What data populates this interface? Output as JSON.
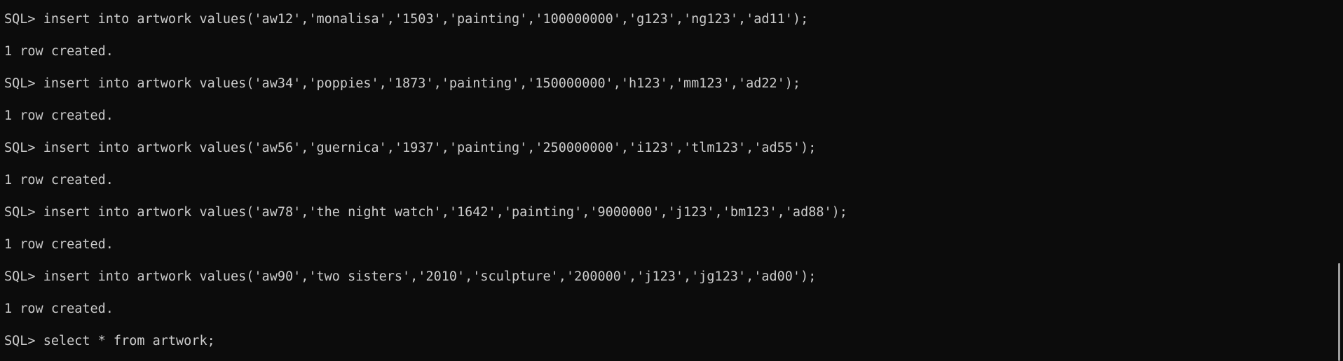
{
  "terminal": {
    "background": "#0c0c0c",
    "foreground": "#cccccc",
    "scrollbar_color": "#9e9e9e",
    "lines": [
      "SQL> insert into artwork values('aw12','monalisa','1503','painting','100000000','g123','ng123','ad11');",
      "1 row created.",
      "SQL> insert into artwork values('aw34','poppies','1873','painting','150000000','h123','mm123','ad22');",
      "1 row created.",
      "SQL> insert into artwork values('aw56','guernica','1937','painting','250000000','i123','tlm123','ad55');",
      "1 row created.",
      "SQL> insert into artwork values('aw78','the night watch','1642','painting','9000000','j123','bm123','ad88');",
      "1 row created.",
      "SQL> insert into artwork values('aw90','two sisters','2010','sculpture','200000','j123','jg123','ad00');",
      "1 row created.",
      "SQL> select * from artwork;"
    ]
  }
}
